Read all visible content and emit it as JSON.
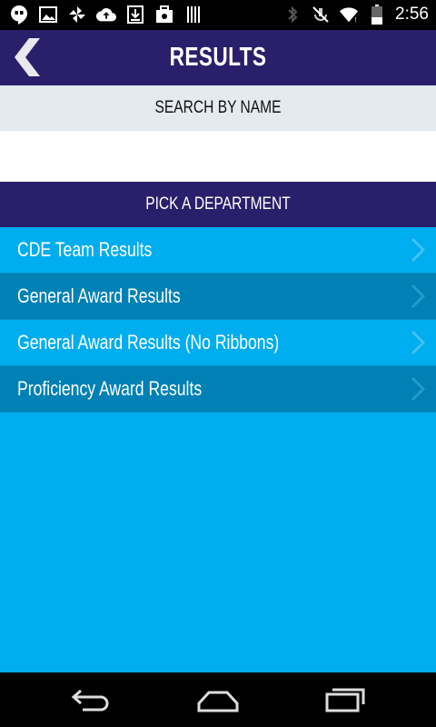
{
  "status_bar": {
    "time": "2:56",
    "left_icons": [
      "hangouts-icon",
      "image-icon",
      "pinwheel-icon",
      "cloud-upload-icon",
      "download-icon",
      "briefcase-icon",
      "barcode-icon"
    ],
    "right_icons": [
      "bluetooth-icon",
      "mute-icon",
      "wifi-icon",
      "battery-icon"
    ]
  },
  "header": {
    "title": "RESULTS",
    "back_icon": "back-chevron-icon",
    "background": "#2a1f6a"
  },
  "search": {
    "label": "SEARCH BY NAME",
    "placeholder": "",
    "value": ""
  },
  "department": {
    "label": "PICK A DEPARTMENT",
    "items": [
      {
        "label": "CDE Team Results"
      },
      {
        "label": "General Award Results"
      },
      {
        "label": "General Award Results (No Ribbons)"
      },
      {
        "label": "Proficiency Award Results"
      }
    ]
  },
  "colors": {
    "accent_light": "#00adef",
    "accent_dark": "#0081b5",
    "header": "#2a1f6a"
  },
  "nav_bar": {
    "icons": [
      "back-icon",
      "home-icon",
      "recent-apps-icon"
    ]
  }
}
